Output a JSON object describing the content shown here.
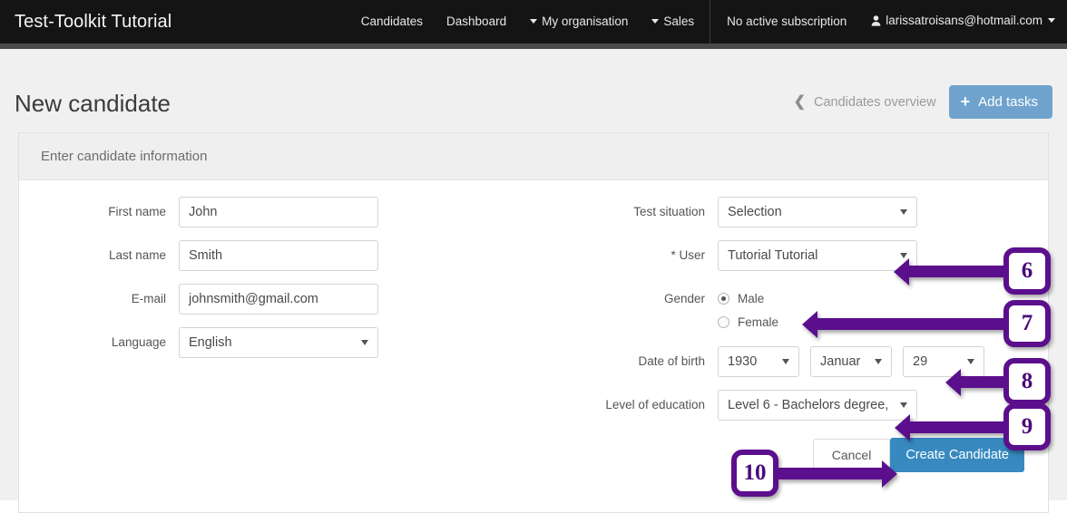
{
  "navbar": {
    "brand": "Test-Toolkit Tutorial",
    "links": [
      {
        "label": "Candidates",
        "caret": false
      },
      {
        "label": "Dashboard",
        "caret": false
      },
      {
        "label": "My organisation",
        "caret": true
      },
      {
        "label": "Sales",
        "caret": true
      }
    ],
    "subscription": "No active subscription",
    "account": "larissatroisans@hotmail.com"
  },
  "header": {
    "title": "New candidate",
    "back_link": "Candidates overview",
    "add_tasks": "Add tasks"
  },
  "panel": {
    "title": "Enter candidate information",
    "left": {
      "first_name_label": "First name",
      "first_name_value": "John",
      "last_name_label": "Last name",
      "last_name_value": "Smith",
      "email_label": "E-mail",
      "email_value": "johnsmith@gmail.com",
      "language_label": "Language",
      "language_value": "English"
    },
    "right": {
      "test_situation_label": "Test situation",
      "test_situation_value": "Selection",
      "user_label": "* User",
      "user_value": "Tutorial Tutorial",
      "gender_label": "Gender",
      "gender_male": "Male",
      "gender_female": "Female",
      "gender_selected": "Male",
      "dob_label": "Date of birth",
      "dob_year": "1930",
      "dob_month": "Januar",
      "dob_day": "29",
      "education_label": "Level of education",
      "education_value": "Level 6 - Bachelors degree,"
    },
    "actions": {
      "cancel": "Cancel",
      "create": "Create Candidate"
    }
  },
  "annotations": [
    {
      "number": "6"
    },
    {
      "number": "7"
    },
    {
      "number": "8"
    },
    {
      "number": "9"
    },
    {
      "number": "10"
    }
  ],
  "colors": {
    "navbar_bg": "#141414",
    "accent_blue": "#3789c0",
    "light_blue": "#6fa3ce",
    "annotation_purple": "#5b0f8c",
    "page_bg": "#f0f0f0"
  }
}
